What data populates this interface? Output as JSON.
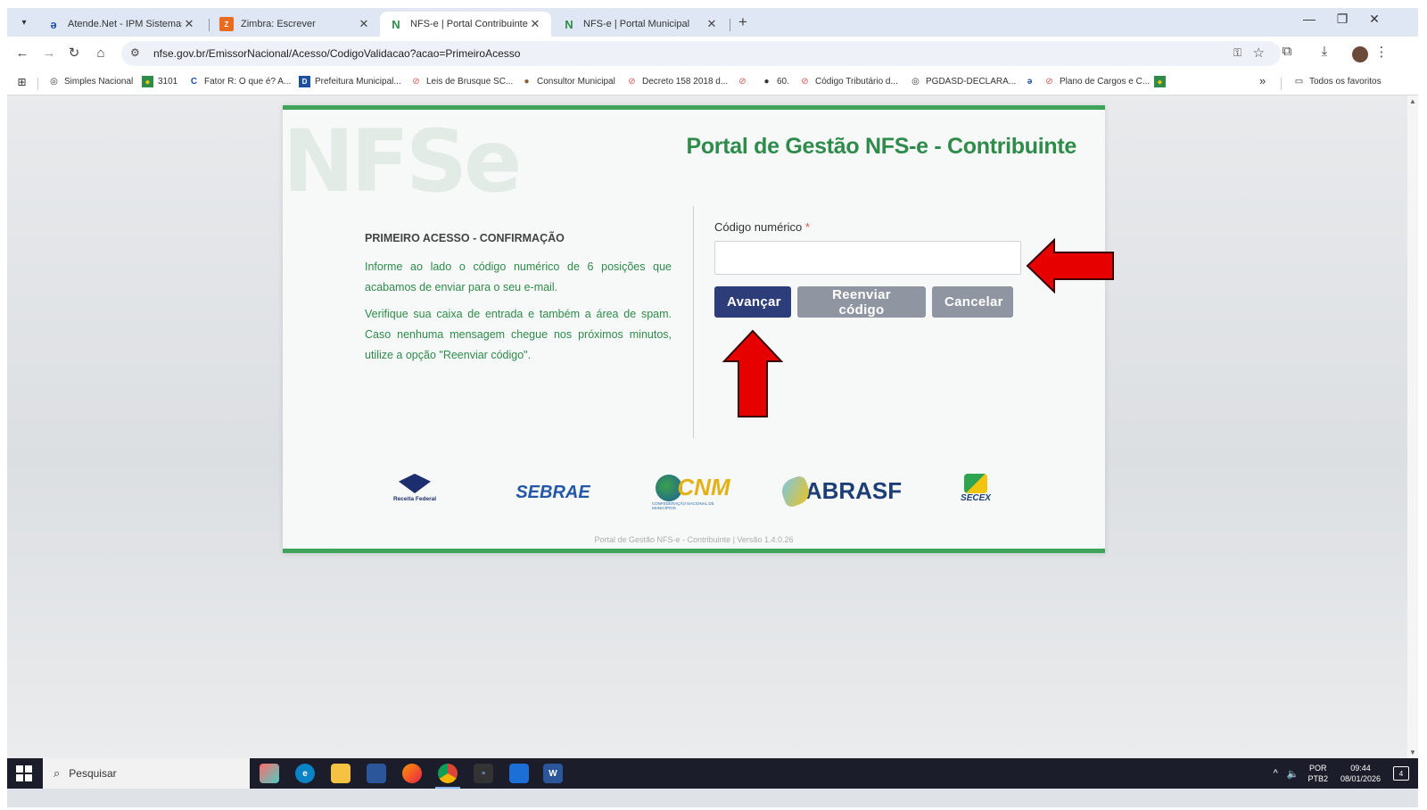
{
  "browser": {
    "tabs": [
      {
        "title": "Atende.Net - IPM Sistemas Ltda",
        "icon": "atende-icon",
        "active": false
      },
      {
        "title": "Zimbra: Escrever",
        "icon": "zimbra-icon",
        "active": false
      },
      {
        "title": "NFS-e | Portal Contribuinte",
        "icon": "nfse-icon",
        "active": true
      },
      {
        "title": "NFS-e | Portal Municipal",
        "icon": "nfse-icon",
        "active": false
      }
    ],
    "close_glyph": "✕",
    "new_tab_glyph": "+",
    "url": "nfse.gov.br/EmissorNacional/Acesso/CodigoValidacao?acao=PrimeiroAcesso",
    "bookmarks": [
      {
        "label": "Simples Nacional",
        "icon": "globe-icon"
      },
      {
        "label": "3101",
        "icon": "flag-icon"
      },
      {
        "label": "Fator R: O que é? A...",
        "icon": "c-icon"
      },
      {
        "label": "Prefeitura Municipal...",
        "icon": "d-icon"
      },
      {
        "label": "Leis de Brusque SC...",
        "icon": "leis-icon"
      },
      {
        "label": "Consultor Municipal",
        "icon": "person-icon"
      },
      {
        "label": "Decreto 158 2018 d...",
        "icon": "leis-icon"
      },
      {
        "label": "",
        "icon": "leis-icon"
      },
      {
        "label": "60.",
        "icon": "person-icon"
      },
      {
        "label": "Código Tributário d...",
        "icon": "leis-icon"
      },
      {
        "label": "PGDASD-DECLARA...",
        "icon": "globe-icon"
      },
      {
        "label": "",
        "icon": "atende-icon"
      },
      {
        "label": "Plano de Cargos e C...",
        "icon": "leis-icon"
      },
      {
        "label": "",
        "icon": "flag-icon"
      }
    ],
    "more_bookmarks": "»",
    "all_bookmarks": "Todos os favoritos"
  },
  "page": {
    "watermark": "NFSe",
    "title": "Portal de Gestão NFS-e - Contribuinte",
    "left": {
      "heading": "PRIMEIRO ACESSO - CONFIRMAÇÃO",
      "paragraph1": "Informe ao lado o código numérico de 6 posições que acabamos de enviar para o seu e-mail.",
      "paragraph2": "Verifique sua caixa de entrada e também a área de spam. Caso nenhuma mensagem chegue nos próximos minutos, utilize a opção \"Reenviar código\"."
    },
    "form": {
      "label": "Código numérico",
      "required_mark": "*",
      "value": "",
      "buttons": {
        "next": "Avançar",
        "resend": "Reenviar código",
        "cancel": "Cancelar"
      }
    },
    "logos": {
      "receita": "Receita Federal",
      "sebrae": "SEBRAE",
      "cnm": "CNM",
      "cnm_sub": "CONFEDERAÇÃO NACIONAL DE MUNICÍPIOS",
      "abrasf": "ABRASF",
      "secex": "SECEX"
    },
    "footer": "Portal de Gestão NFS-e - Contribuinte | Versão 1.4.0.26"
  },
  "taskbar": {
    "search_placeholder": "Pesquisar",
    "lang_line1": "POR",
    "lang_line2": "PTB2",
    "time": "09:44",
    "date": "08/01/2026",
    "notification_count": "4"
  },
  "colors": {
    "brand_green": "#2e8b4a",
    "button_primary": "#2d3d7a",
    "button_secondary": "#8f95a1",
    "annotation_arrow": "#e60000"
  }
}
